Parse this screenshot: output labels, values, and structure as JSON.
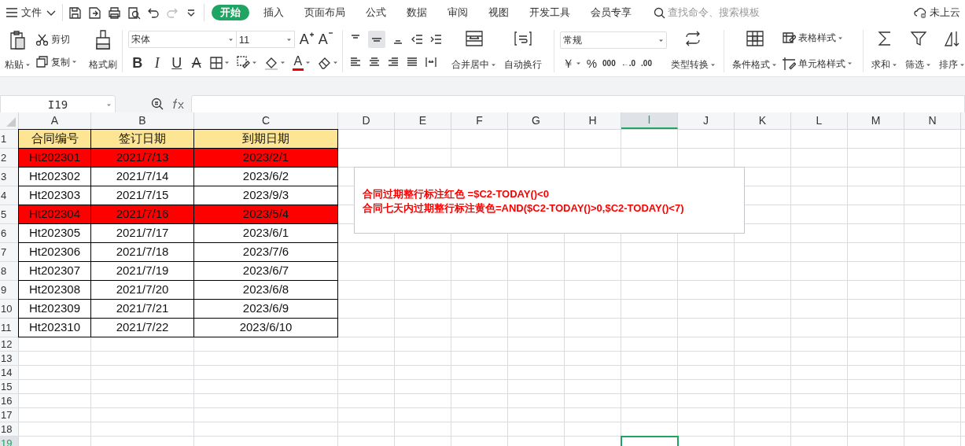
{
  "menu": {
    "file": "文件",
    "tabs": [
      {
        "label": "开始",
        "selected": true
      },
      {
        "label": "插入",
        "selected": false
      },
      {
        "label": "页面布局",
        "selected": false
      },
      {
        "label": "公式",
        "selected": false
      },
      {
        "label": "数据",
        "selected": false
      },
      {
        "label": "审阅",
        "selected": false
      },
      {
        "label": "视图",
        "selected": false
      },
      {
        "label": "开发工具",
        "selected": false
      },
      {
        "label": "会员专享",
        "selected": false
      }
    ],
    "search": {
      "placeholder": "查找命令、搜索模板"
    },
    "cloud": "未上云"
  },
  "ribbon": {
    "clipboard": {
      "paste": "粘贴",
      "cut": "剪切",
      "copy": "复制",
      "format_painter": "格式刷"
    },
    "font": {
      "name": "宋体",
      "size": "11",
      "size_buttons": [
        {
          "kind": "grow",
          "label": "A"
        },
        {
          "kind": "shrink",
          "label": "A"
        }
      ],
      "format_buttons": [
        {
          "kind": "bold",
          "label": "B"
        },
        {
          "kind": "italic",
          "label": "I"
        },
        {
          "kind": "underline",
          "label": "U"
        },
        {
          "kind": "strike",
          "label": "A"
        }
      ],
      "font_color": "A"
    },
    "alignment": {
      "merge": "合并居中",
      "wrap": "自动换行"
    },
    "number": {
      "format": "常规",
      "buttons": [
        "￥",
        "%",
        "000",
        "←.0",
        ".00"
      ],
      "convert": "类型转换"
    },
    "styles": {
      "conditional": "条件格式",
      "table_style": "表格样式",
      "cell_style": "单元格样式"
    },
    "editing": {
      "sum": "求和",
      "filter": "筛选",
      "sort": "排序"
    }
  },
  "formula_bar": {
    "name_box": "I19"
  },
  "sheet": {
    "columns": [
      {
        "label": "A",
        "selected": false
      },
      {
        "label": "B",
        "selected": false
      },
      {
        "label": "C",
        "selected": false
      },
      {
        "label": "D",
        "selected": false
      },
      {
        "label": "E",
        "selected": false
      },
      {
        "label": "F",
        "selected": false
      },
      {
        "label": "G",
        "selected": false
      },
      {
        "label": "H",
        "selected": false
      },
      {
        "label": "I",
        "selected": true
      },
      {
        "label": "J",
        "selected": false
      },
      {
        "label": "K",
        "selected": false
      },
      {
        "label": "L",
        "selected": false
      },
      {
        "label": "M",
        "selected": false
      },
      {
        "label": "N",
        "selected": false
      }
    ],
    "rows": [
      {
        "header": "1",
        "kind": "title",
        "selected": false,
        "cells": [
          "合同编号",
          "签订日期",
          "到期日期"
        ]
      },
      {
        "header": "2",
        "kind": "data",
        "highlighted": true,
        "selected": false,
        "cells": [
          "Ht202301",
          "2021/7/13",
          "2023/2/1"
        ]
      },
      {
        "header": "3",
        "kind": "data",
        "highlighted": false,
        "selected": false,
        "cells": [
          "Ht202302",
          "2021/7/14",
          "2023/6/2"
        ]
      },
      {
        "header": "4",
        "kind": "data",
        "highlighted": false,
        "selected": false,
        "cells": [
          "Ht202303",
          "2021/7/15",
          "2023/9/3"
        ]
      },
      {
        "header": "5",
        "kind": "data",
        "highlighted": true,
        "selected": false,
        "cells": [
          "Ht202304",
          "2021/7/16",
          "2023/5/4"
        ]
      },
      {
        "header": "6",
        "kind": "data",
        "highlighted": false,
        "selected": false,
        "cells": [
          "Ht202305",
          "2021/7/17",
          "2023/6/1"
        ]
      },
      {
        "header": "7",
        "kind": "data",
        "highlighted": false,
        "selected": false,
        "cells": [
          "Ht202306",
          "2021/7/18",
          "2023/7/6"
        ]
      },
      {
        "header": "8",
        "kind": "data",
        "highlighted": false,
        "selected": false,
        "cells": [
          "Ht202307",
          "2021/7/19",
          "2023/6/7"
        ]
      },
      {
        "header": "9",
        "kind": "data",
        "highlighted": false,
        "selected": false,
        "cells": [
          "Ht202308",
          "2021/7/20",
          "2023/6/8"
        ]
      },
      {
        "header": "10",
        "kind": "data",
        "highlighted": false,
        "selected": false,
        "cells": [
          "Ht202309",
          "2021/7/21",
          "2023/6/9"
        ]
      },
      {
        "header": "11",
        "kind": "data",
        "highlighted": false,
        "selected": false,
        "cells": [
          "Ht202310",
          "2021/7/22",
          "2023/6/10"
        ]
      },
      {
        "header": "12",
        "kind": "empty",
        "selected": false
      },
      {
        "header": "13",
        "kind": "empty",
        "selected": false
      },
      {
        "header": "14",
        "kind": "empty",
        "selected": false
      },
      {
        "header": "15",
        "kind": "empty",
        "selected": false
      },
      {
        "header": "16",
        "kind": "empty",
        "selected": false
      },
      {
        "header": "17",
        "kind": "empty",
        "selected": false
      },
      {
        "header": "18",
        "kind": "empty",
        "selected": false
      },
      {
        "header": "19",
        "kind": "empty",
        "selected": true
      }
    ],
    "text_box": [
      "合同过期整行标注红色  =$C2-TODAY()<0",
      "合同七天内过期整行标注黄色=AND($C2-TODAY()>0,$C2-TODAY()<7)"
    ]
  }
}
